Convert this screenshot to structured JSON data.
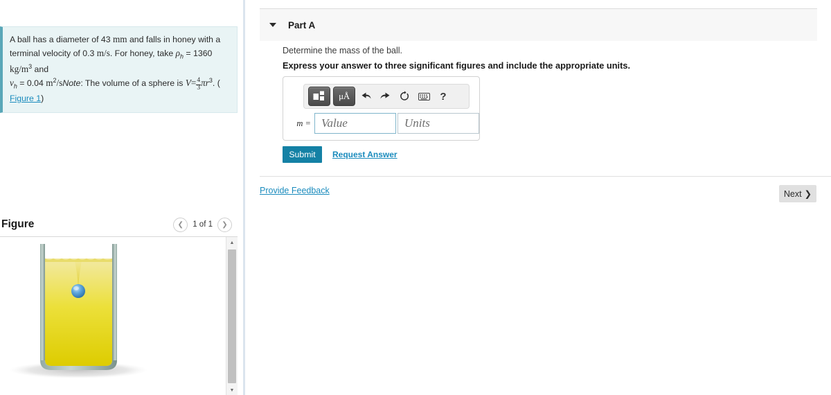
{
  "problem": {
    "line1_a": "A ball has a diameter of 43",
    "unit_mm": "mm",
    "line1_b": "and falls in honey with a terminal",
    "line2_a": "velocity of 0.3",
    "unit_ms": "m/s",
    "line2_b": ". For honey, take",
    "rho_symbol": "ρ",
    "rho_sub": "h",
    "rho_eq": "= 1360",
    "unit_kgm3_base": "kg/m",
    "unit_kgm3_exp": "3",
    "line2_c": "and",
    "nu_symbol": "ν",
    "nu_sub": "h",
    "nu_eq": "= 0.04",
    "unit_m2s_base": "m",
    "unit_m2s_exp": "2",
    "unit_m2s_rest": "/s",
    "note_label": "Note",
    "note_text": ": The volume of a sphere is",
    "vol_V": "V",
    "vol_eq": "=",
    "frac_num": "4",
    "frac_den": "3",
    "vol_pi_r": "πr",
    "vol_exp": "3",
    "paren_open": ". (",
    "figure_link": "Figure 1",
    "paren_close": ")"
  },
  "figure": {
    "title": "Figure",
    "prev_icon": "chevron-left-icon",
    "count": "1 of 1",
    "next_icon": "chevron-right-icon",
    "scroll_up": "▲",
    "scroll_down": "▼"
  },
  "part": {
    "caret_icon": "caret-down-icon",
    "label": "Part A",
    "prompt": "Determine the mass of the ball.",
    "prompt_bold": "Express your answer to three significant figures and include the appropriate units."
  },
  "toolbar": {
    "template_icon": "math-template-icon",
    "units_label": "μÅ",
    "undo_icon": "undo-arrow-icon",
    "redo_icon": "redo-arrow-icon",
    "reset_icon": "reset-circular-arrow-icon",
    "keyboard_icon": "keyboard-icon",
    "help_label": "?"
  },
  "answer": {
    "equals_label": "m =",
    "value_placeholder": "Value",
    "value_text": "",
    "units_placeholder": "Units",
    "units_text": ""
  },
  "actions": {
    "submit_label": "Submit",
    "request_answer_label": "Request Answer",
    "provide_feedback_label": "Provide Feedback",
    "next_label": "Next",
    "next_icon": "chevron-right-icon"
  },
  "colors": {
    "accent_teal": "#1481a5",
    "link_blue": "#1a8bbd",
    "problem_bg": "#e9f4f5",
    "problem_border": "#5aa7b8",
    "honey_light": "#efe38a",
    "honey_dark": "#e0cf00",
    "ball_blue": "#4f9fd6",
    "glass_gray": "#7e9690"
  }
}
